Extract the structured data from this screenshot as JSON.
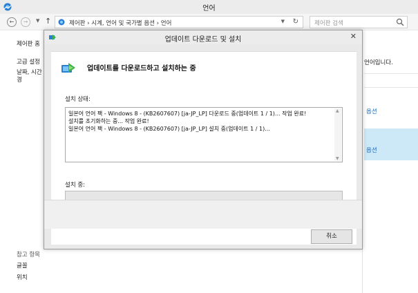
{
  "window": {
    "title": "언어"
  },
  "navbar": {
    "back_icon": "back-arrow-icon",
    "forward_icon": "forward-arrow-icon",
    "dropdown_icon": "chevron-down-icon",
    "up_icon": "up-arrow-icon",
    "breadcrumb": "제어판  ›  시계, 언어 및 국가별 옵션  ›  언어",
    "refresh_icon": "refresh-icon",
    "search_placeholder": "제어판 검색"
  },
  "sidebar": {
    "items": [
      {
        "label": "제어판 홈"
      },
      {
        "label": "고급 설정"
      },
      {
        "label": "날짜, 시간"
      },
      {
        "label": "경"
      }
    ],
    "see_also": {
      "title": "참고 항목",
      "links": [
        {
          "label": "글꼴"
        },
        {
          "label": "위치"
        }
      ]
    }
  },
  "main_right": {
    "text_1": "언어입니다.",
    "link_1": "옵션",
    "link_2": "옵션"
  },
  "dialog": {
    "title": "업데이트 다운로드 및 설치",
    "heading": "업데이트를 다운로드하고 설치하는 중",
    "status_label": "설치 상태:",
    "log_lines": [
      "일본어 언어 팩 - Windows 8 - (KB2607607) [ja-JP_LP] 다운로드 중(업데이트 1 / 1)... 작업 완료!",
      "설치를 초기화하는 중... 작업 완료!",
      "일본어 언어 팩 - Windows 8 - (KB2607607) [ja-JP_LP] 설치 중(업데이트 1 / 1)..."
    ],
    "progress_label": "설치 중:",
    "progress_value": 0,
    "cancel_label": "취소"
  },
  "colors": {
    "selection": "#cde8f7",
    "link": "#1e6bb8",
    "progress_fill": "#06b025"
  }
}
